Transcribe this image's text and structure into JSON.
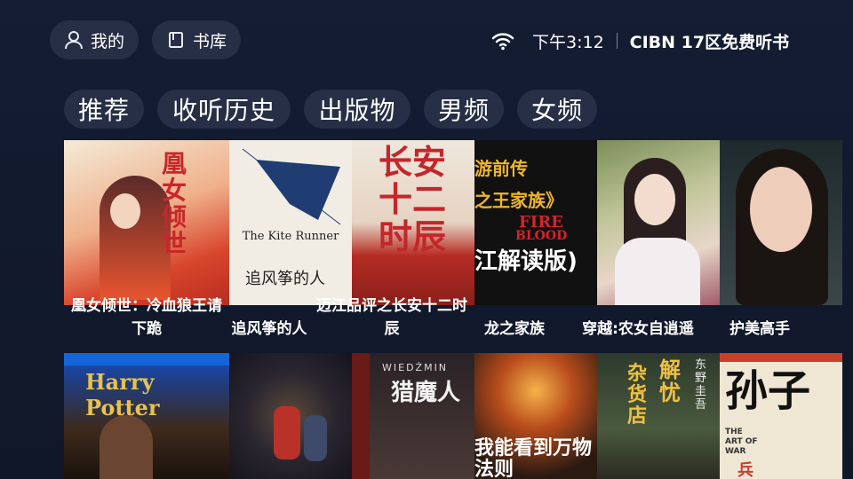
{
  "header": {
    "mine_label": "我的",
    "library_label": "书库",
    "time": "下午3:12",
    "brand": "CIBN 17区免费听书"
  },
  "tabs": [
    {
      "label": "推荐"
    },
    {
      "label": "收听历史"
    },
    {
      "label": "出版物"
    },
    {
      "label": "男频"
    },
    {
      "label": "女频"
    }
  ],
  "row1": [
    {
      "title": "凰女倾世：冷血狼王请下跪",
      "cover_text": "凰女倾世"
    },
    {
      "title": "追风筝的人",
      "cover_text_en": "The Kite Runner",
      "cover_text": "追风筝的人"
    },
    {
      "title": "迈江品评之长安十二时辰",
      "cover_text": "长安十二时辰"
    },
    {
      "title": "龙之家族",
      "cover_text_1": "游前传",
      "cover_text_2": "之王家族》",
      "cover_text_3": "FIRE",
      "cover_text_4": "BLOOD",
      "cover_text_5": "江解读版)"
    },
    {
      "title": "穿越:农女自逍遥"
    },
    {
      "title": "护美高手"
    }
  ],
  "row2": [
    {
      "cover_text": "Harry Potter"
    },
    {
      "cover_text": ""
    },
    {
      "cover_text": "猎魔人",
      "cover_text_en": "WIEDŹMIN"
    },
    {
      "cover_text": "我能看到万物法则"
    },
    {
      "cover_text_1": "解忧",
      "cover_text_2": "杂货店",
      "cover_text_3": "东野圭吾"
    },
    {
      "cover_text_1": "孙子",
      "cover_text_2": "THE ART OF WAR",
      "cover_text_3": "兵"
    }
  ]
}
